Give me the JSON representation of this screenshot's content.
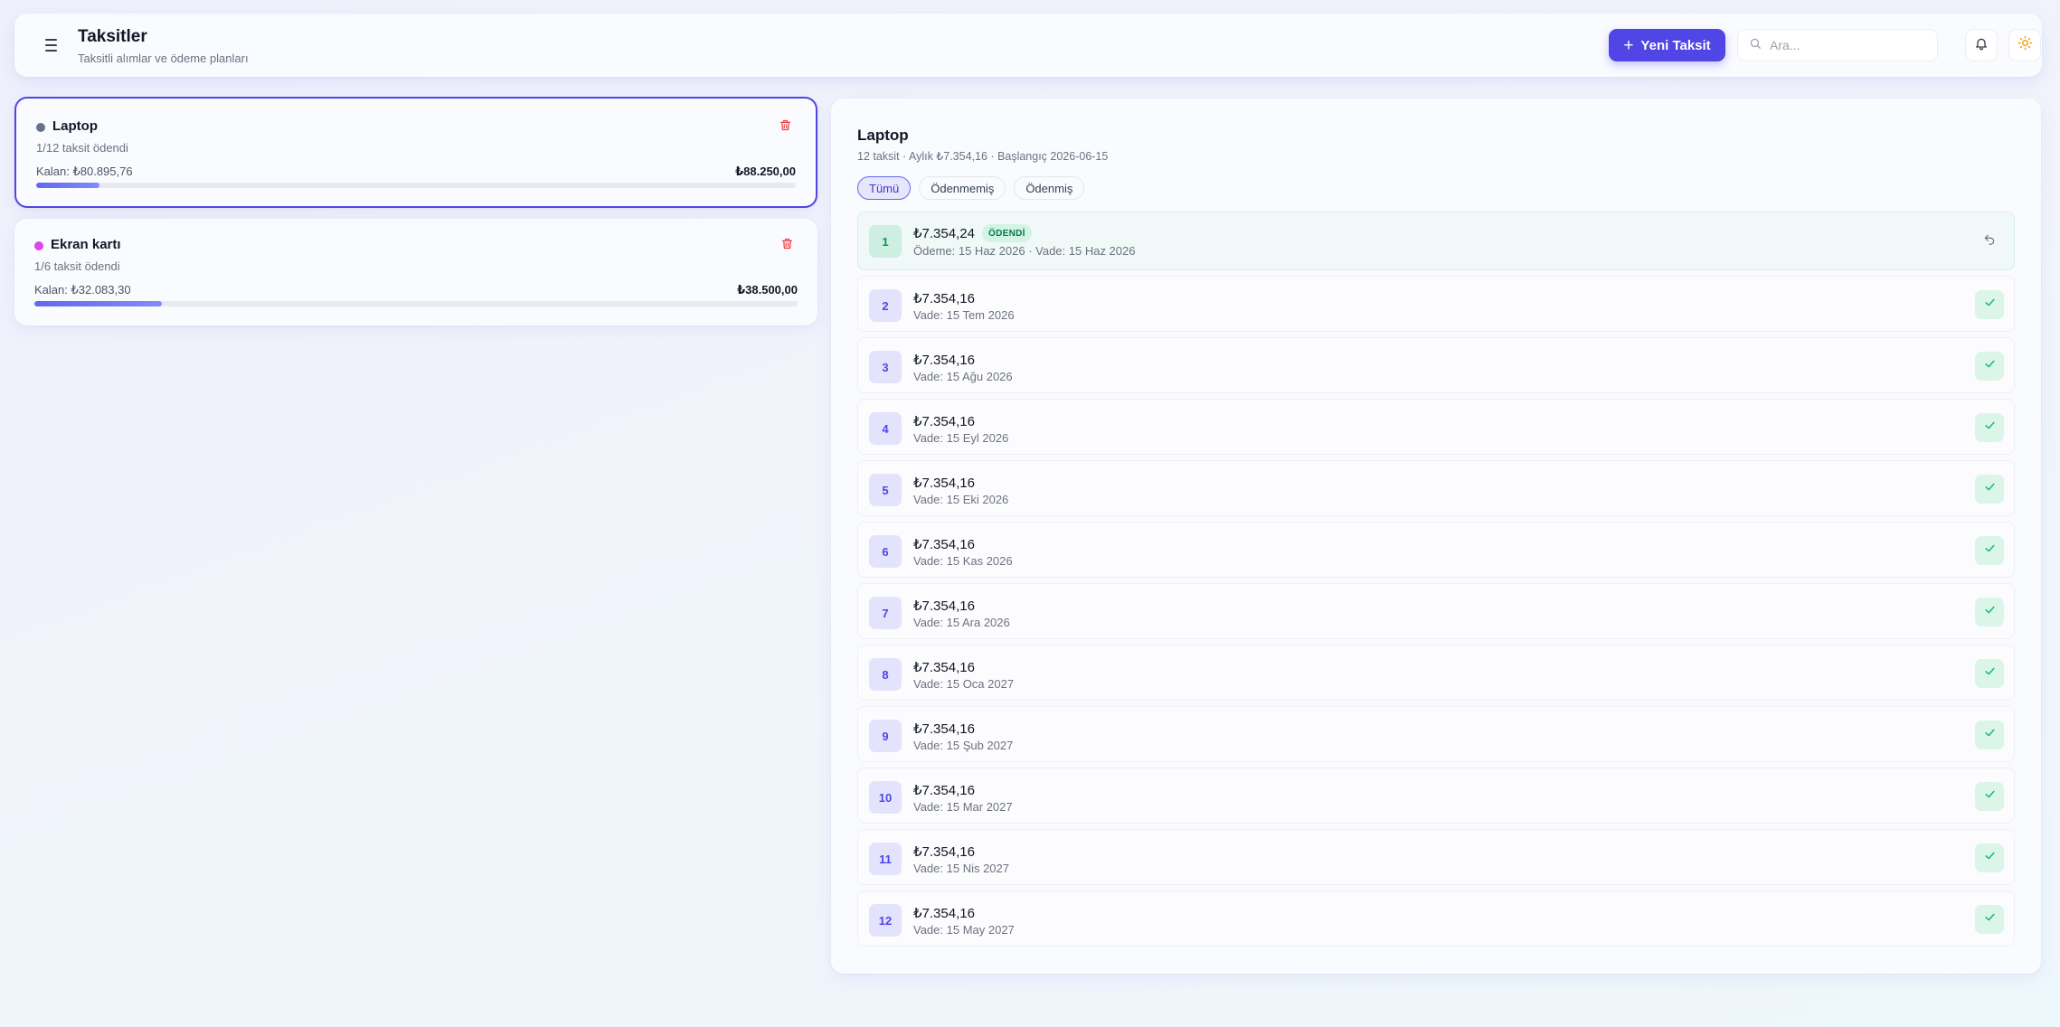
{
  "header": {
    "title": "Taksitler",
    "subtitle": "Taksitli alımlar ve ödeme planları",
    "new_button_label": "Yeni Taksit",
    "search_placeholder": "Ara...",
    "icons": {
      "menu": "menu-icon",
      "plus": "plus-icon",
      "search": "search-icon",
      "notifications": "bell-icon",
      "theme": "sun-icon"
    }
  },
  "plans": [
    {
      "name": "Laptop",
      "dot_color": "#64748b",
      "paid_text": "1/12 taksit ödendi",
      "remaining_text": "Kalan: ₺80.895,76",
      "total_text": "₺88.250,00",
      "progress": 0.0833,
      "selected": true
    },
    {
      "name": "Ekran kartı",
      "dot_color": "#d946ef",
      "paid_text": "1/6 taksit ödendi",
      "remaining_text": "Kalan: ₺32.083,30",
      "total_text": "₺38.500,00",
      "progress": 0.1667,
      "selected": false
    }
  ],
  "detail": {
    "title": "Laptop",
    "meta": "12 taksit · Aylık ₺7.354,16 · Başlangıç 2026-06-15",
    "filters": [
      {
        "label": "Tümü",
        "active": true
      },
      {
        "label": "Ödenmemiş",
        "active": false
      },
      {
        "label": "Ödenmiş",
        "active": false
      }
    ],
    "installments": [
      {
        "no": "1",
        "amount": "₺7.354,24",
        "badge": "ÖDENDİ",
        "date_text": "Ödeme: 15 Haz 2026 · Vade: 15 Haz 2026",
        "paid": true
      },
      {
        "no": "2",
        "amount": "₺7.354,16",
        "date_text": "Vade: 15 Tem 2026",
        "paid": false
      },
      {
        "no": "3",
        "amount": "₺7.354,16",
        "date_text": "Vade: 15 Ağu 2026",
        "paid": false
      },
      {
        "no": "4",
        "amount": "₺7.354,16",
        "date_text": "Vade: 15 Eyl 2026",
        "paid": false
      },
      {
        "no": "5",
        "amount": "₺7.354,16",
        "date_text": "Vade: 15 Eki 2026",
        "paid": false
      },
      {
        "no": "6",
        "amount": "₺7.354,16",
        "date_text": "Vade: 15 Kas 2026",
        "paid": false
      },
      {
        "no": "7",
        "amount": "₺7.354,16",
        "date_text": "Vade: 15 Ara 2026",
        "paid": false
      },
      {
        "no": "8",
        "amount": "₺7.354,16",
        "date_text": "Vade: 15 Oca 2027",
        "paid": false
      },
      {
        "no": "9",
        "amount": "₺7.354,16",
        "date_text": "Vade: 15 Şub 2027",
        "paid": false
      },
      {
        "no": "10",
        "amount": "₺7.354,16",
        "date_text": "Vade: 15 Mar 2027",
        "paid": false
      },
      {
        "no": "11",
        "amount": "₺7.354,16",
        "date_text": "Vade: 15 Nis 2027",
        "paid": false
      },
      {
        "no": "12",
        "amount": "₺7.354,16",
        "date_text": "Vade: 15 May 2027",
        "paid": false
      }
    ]
  },
  "colors": {
    "accent": "#4f46e5",
    "paid_green": "#059669",
    "danger": "#ef4444"
  }
}
